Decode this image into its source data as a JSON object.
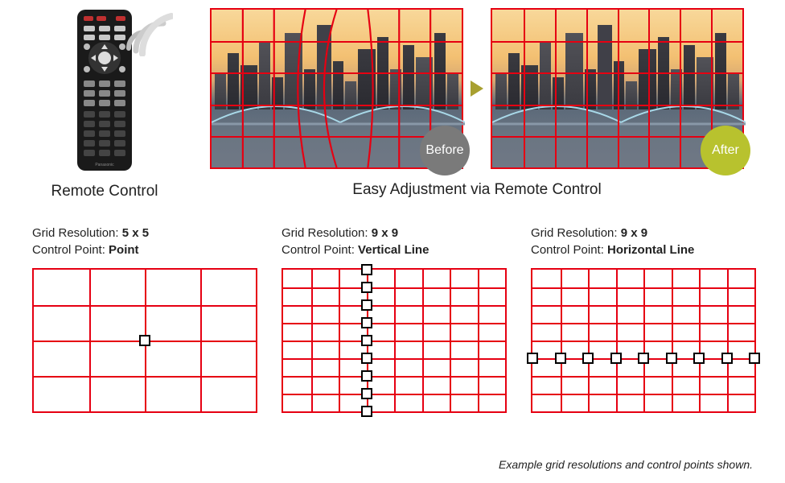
{
  "top": {
    "remote_caption": "Remote Control",
    "adjust_caption": "Easy Adjustment via Remote Control",
    "before_label": "Before",
    "after_label": "After",
    "before_grid": {
      "cols": 8,
      "rows": 5,
      "warped": true
    },
    "after_grid": {
      "cols": 8,
      "rows": 5,
      "warped": false
    }
  },
  "examples": [
    {
      "res_label": "Grid Resolution: ",
      "res_value": "5 x 5",
      "cp_label": "Control Point: ",
      "cp_value": "Point",
      "cols": 4,
      "rows": 4,
      "control_points": [
        {
          "x": 0.5,
          "y": 0.5
        }
      ]
    },
    {
      "res_label": "Grid Resolution: ",
      "res_value": "9 x 9",
      "cp_label": "Control Point: ",
      "cp_value": "Vertical Line",
      "cols": 8,
      "rows": 8,
      "control_points": [
        {
          "x": 0.375,
          "y": 0.0
        },
        {
          "x": 0.375,
          "y": 0.125
        },
        {
          "x": 0.375,
          "y": 0.25
        },
        {
          "x": 0.375,
          "y": 0.375
        },
        {
          "x": 0.375,
          "y": 0.5
        },
        {
          "x": 0.375,
          "y": 0.625
        },
        {
          "x": 0.375,
          "y": 0.75
        },
        {
          "x": 0.375,
          "y": 0.875
        },
        {
          "x": 0.375,
          "y": 1.0
        }
      ]
    },
    {
      "res_label": "Grid Resolution: ",
      "res_value": "9 x 9",
      "cp_label": "Control Point: ",
      "cp_value": "Horizontal Line",
      "cols": 8,
      "rows": 8,
      "control_points": [
        {
          "x": 0.0,
          "y": 0.625
        },
        {
          "x": 0.125,
          "y": 0.625
        },
        {
          "x": 0.25,
          "y": 0.625
        },
        {
          "x": 0.375,
          "y": 0.625
        },
        {
          "x": 0.5,
          "y": 0.625
        },
        {
          "x": 0.625,
          "y": 0.625
        },
        {
          "x": 0.75,
          "y": 0.625
        },
        {
          "x": 0.875,
          "y": 0.625
        },
        {
          "x": 1.0,
          "y": 0.625
        }
      ]
    }
  ],
  "footnote": "Example grid resolutions and control points shown.",
  "colors": {
    "grid_line": "#e60012",
    "before_badge": "#7a7a7a",
    "after_badge": "#b8c22e"
  }
}
